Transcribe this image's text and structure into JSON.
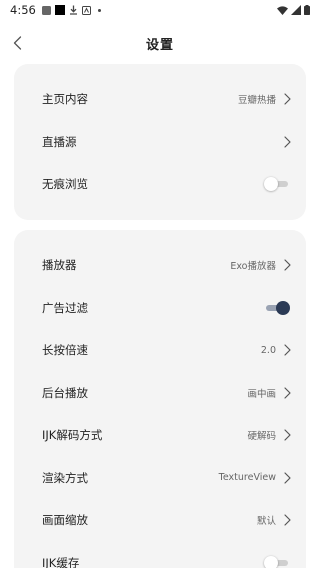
{
  "status_bar": {
    "time": "4:56",
    "icons_left": [
      "notification-gray-icon",
      "notification-black-icon",
      "download-icon",
      "app-icon",
      "dot-icon"
    ],
    "icons_right": [
      "wifi-icon",
      "signal-icon",
      "battery-icon"
    ]
  },
  "header": {
    "title": "设置",
    "back_icon": "chevron-left-icon"
  },
  "settings_group_1": [
    {
      "label": "主页内容",
      "value": "豆瓣热播",
      "control": "chevron"
    },
    {
      "label": "直播源",
      "value": "",
      "control": "chevron"
    },
    {
      "label": "无痕浏览",
      "value": "",
      "control": "toggle",
      "on": false
    }
  ],
  "settings_group_2": [
    {
      "label": "播放器",
      "value": "Exo播放器",
      "control": "chevron"
    },
    {
      "label": "广告过滤",
      "value": "",
      "control": "toggle",
      "on": true
    },
    {
      "label": "长按倍速",
      "value": "2.0",
      "control": "chevron"
    },
    {
      "label": "后台播放",
      "value": "画中画",
      "control": "chevron"
    },
    {
      "label": "IJK解码方式",
      "value": "硬解码",
      "control": "chevron"
    },
    {
      "label": "渲染方式",
      "value": "TextureView",
      "control": "chevron"
    },
    {
      "label": "画面缩放",
      "value": "默认",
      "control": "chevron"
    },
    {
      "label": "IJK缓存",
      "value": "",
      "control": "toggle",
      "on": false
    }
  ],
  "colors": {
    "card_bg": "#f4f4f4",
    "toggle_on_knob": "#2b3a55",
    "toggle_on_track": "#9aa3b3",
    "toggle_off_track": "#cfcfcf"
  }
}
